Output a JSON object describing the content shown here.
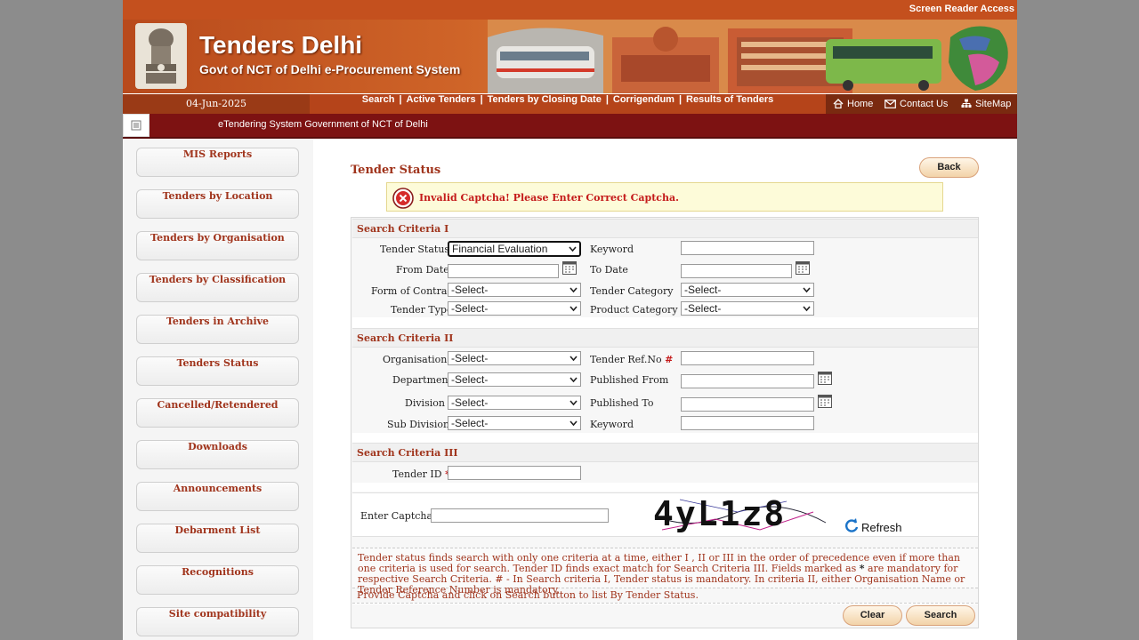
{
  "header": {
    "screen_reader": "Screen Reader Access",
    "title": "Tenders Delhi",
    "subtitle": "Govt of NCT of Delhi e-Procurement System"
  },
  "nav": {
    "date": "04-Jun-2025",
    "links": [
      "Search",
      "Active Tenders",
      "Tenders by Closing Date",
      "Corrigendum",
      "Results of Tenders"
    ],
    "separator": "|",
    "right": {
      "home": "Home",
      "contact": "Contact Us",
      "sitemap": "SiteMap"
    }
  },
  "ticker": {
    "text": "eTendering System Government of NCT of Delhi"
  },
  "sidebar": {
    "items": [
      {
        "label": "MIS Reports"
      },
      {
        "label": "Tenders by Location"
      },
      {
        "label": "Tenders by Organisation"
      },
      {
        "label": "Tenders by Classification"
      },
      {
        "label": "Tenders in Archive"
      },
      {
        "label": "Tenders Status"
      },
      {
        "label": "Cancelled/Retendered"
      },
      {
        "label": "Downloads"
      },
      {
        "label": "Announcements"
      },
      {
        "label": "Debarment List"
      },
      {
        "label": "Recognitions"
      },
      {
        "label": "Site compatibility"
      }
    ]
  },
  "main": {
    "title": "Tender Status",
    "back": "Back",
    "error": "Invalid Captcha! Please Enter Correct Captcha.",
    "criteria1": {
      "heading": "Search Criteria I",
      "tender_status_label": "Tender Status",
      "tender_status_value": "Financial Evaluation",
      "keyword_label": "Keyword",
      "from_date_label": "From Date",
      "to_date_label": "To Date",
      "form_of_contract_label": "Form of Contract",
      "form_of_contract_value": "-Select-",
      "tender_category_label": "Tender Category",
      "tender_category_value": "-Select-",
      "tender_type_label": "Tender Type",
      "tender_type_value": "-Select-",
      "product_category_label": "Product Category",
      "product_category_value": "-Select-"
    },
    "criteria2": {
      "heading": "Search Criteria II",
      "organisation_label": "Organisation",
      "organisation_value": "-Select-",
      "tender_ref_label": "Tender Ref.No",
      "department_label": "Department",
      "department_value": "-Select-",
      "published_from_label": "Published From",
      "division_label": "Division",
      "division_value": "-Select-",
      "published_to_label": "Published To",
      "sub_division_label": "Sub Division",
      "sub_division_value": "-Select-",
      "keyword_label": "Keyword"
    },
    "criteria3": {
      "heading": "Search Criteria III",
      "tender_id_label": "Tender ID"
    },
    "captcha": {
      "label": "Enter Captcha",
      "image_text": "4yL1z8",
      "refresh": "Refresh"
    },
    "mark_hash": "#",
    "mark_star": "*",
    "note1_part1": "Tender status finds search with only one criteria at a time, either I , II or III in the order of precedence even if more than one criteria is used for search. Tender ID finds exact match for Search Criteria III. Fields marked as ",
    "note1_part2": " are mandatory for respective Search Criteria. # - In Search criteria I, Tender status is mandatory. In criteria II, either Organisation Name or Tender Reference Number is mandatory.",
    "note2": "Provide Captcha and click on Search button to list By Tender Status.",
    "clear": "Clear",
    "search": "Search"
  }
}
